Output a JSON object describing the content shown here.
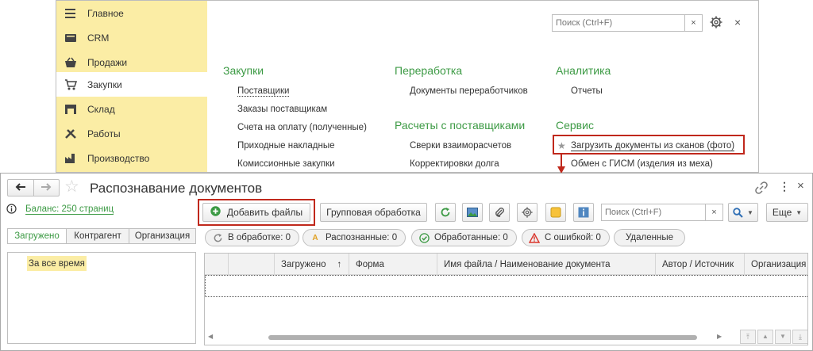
{
  "sidebar": {
    "items": [
      {
        "label": "Главное",
        "icon": "menu-icon"
      },
      {
        "label": "CRM",
        "icon": "crm-icon"
      },
      {
        "label": "Продажи",
        "icon": "basket-icon"
      },
      {
        "label": "Закупки",
        "icon": "cart-icon"
      },
      {
        "label": "Склад",
        "icon": "warehouse-icon"
      },
      {
        "label": "Работы",
        "icon": "tools-icon"
      },
      {
        "label": "Производство",
        "icon": "factory-icon"
      }
    ]
  },
  "top_search": {
    "placeholder": "Поиск (Ctrl+F)",
    "clear": "×"
  },
  "menu": {
    "purchases": {
      "title": "Закупки",
      "links": [
        "Поставщики",
        "Заказы поставщикам",
        "Счета на оплату (полученные)",
        "Приходные накладные",
        "Комиссионные закупки"
      ]
    },
    "processing": {
      "title": "Переработка",
      "links": [
        "Документы переработчиков"
      ]
    },
    "settlements": {
      "title": "Расчеты с поставщиками",
      "links": [
        "Сверки взаиморасчетов",
        "Корректировки долга"
      ]
    },
    "analytics": {
      "title": "Аналитика",
      "links": [
        "Отчеты"
      ]
    },
    "service": {
      "title": "Сервис",
      "links": [
        "Загрузить документы из сканов (фото)",
        "Обмен с ГИСМ (изделия из меха)"
      ]
    }
  },
  "doc": {
    "title": "Распознавание документов",
    "balance": "Баланс: 250 страниц",
    "add_files": "Добавить файлы",
    "group_processing": "Групповая обработка",
    "search_placeholder": "Поиск (Ctrl+F)",
    "clear": "×",
    "more": "Еще",
    "filter_tabs": [
      "Загружено",
      "Контрагент",
      "Организация"
    ],
    "period": "За все время",
    "chips": [
      {
        "label": "В обработке: 0",
        "icon": "refresh-icon",
        "color": "#888888"
      },
      {
        "label": "Распознанные: 0",
        "icon": "recognized-icon",
        "color": "#e0a020"
      },
      {
        "label": "Обработанные: 0",
        "icon": "check-icon",
        "color": "#3c9a44"
      },
      {
        "label": "С ошибкой: 0",
        "icon": "error-icon",
        "color": "#d9342b"
      },
      {
        "label": "Удаленные",
        "icon": "",
        "color": "#333333"
      }
    ],
    "columns": [
      "Загружено",
      "↑",
      "Форма",
      "Имя файла / Наименование документа",
      "Автор / Источник",
      "Организация"
    ]
  },
  "colors": {
    "accent_green": "#3c9a44",
    "sidebar_bg": "#fbeda5",
    "highlight_red": "#c0281c"
  }
}
